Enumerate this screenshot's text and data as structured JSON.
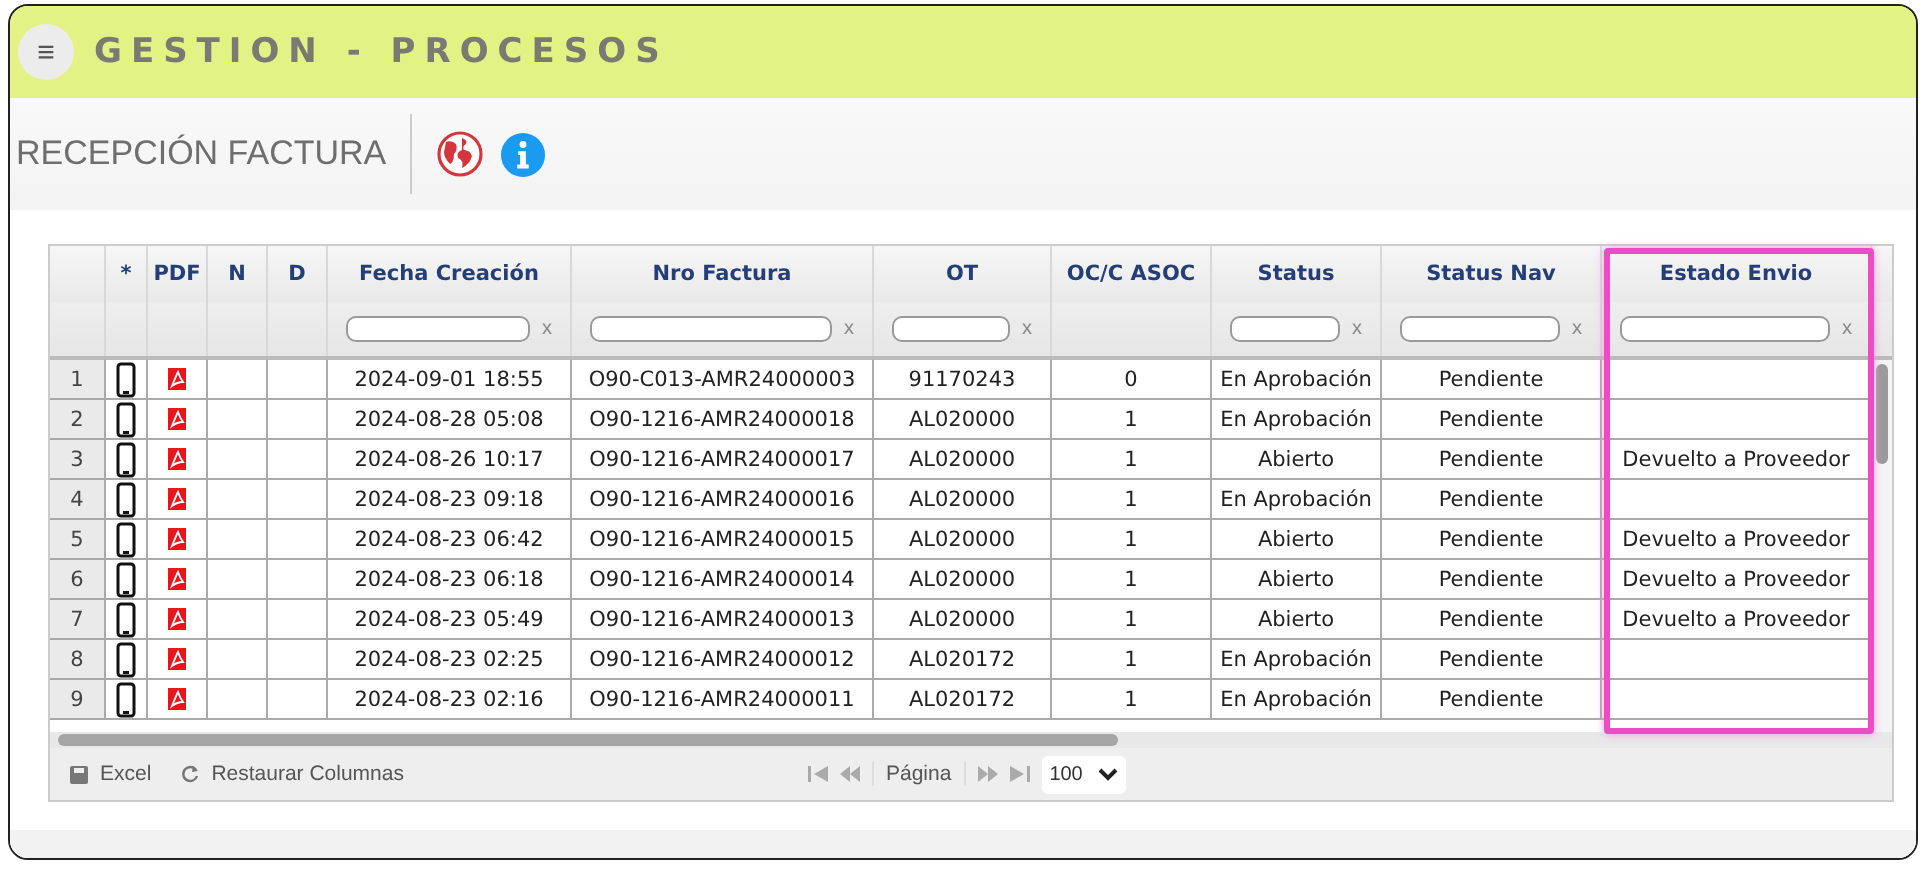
{
  "header": {
    "menu_icon": "≡",
    "title": "GESTION - PROCESOS"
  },
  "toolbar": {
    "title": "RECEPCIÓN FACTURA"
  },
  "table": {
    "columns": [
      {
        "kind": "row_number"
      },
      {
        "label": "*",
        "kind": "device"
      },
      {
        "label": "PDF",
        "kind": "pdf"
      },
      {
        "label": "N",
        "kind": "text"
      },
      {
        "label": "D",
        "kind": "text"
      },
      {
        "label": "Fecha Creación",
        "kind": "text",
        "filter_clear": "x"
      },
      {
        "label": "Nro Factura",
        "kind": "text",
        "filter_clear": "x"
      },
      {
        "label": "OT",
        "kind": "text",
        "filter_clear": "x"
      },
      {
        "label": "OC/C ASOC",
        "kind": "text"
      },
      {
        "label": "Status",
        "kind": "text",
        "filter_clear": "x"
      },
      {
        "label": "Status Nav",
        "kind": "text",
        "filter_clear": "x"
      },
      {
        "label": "Estado Envio",
        "kind": "text",
        "filter_clear": "x",
        "highlighted": true
      }
    ],
    "rows": [
      {
        "cells": [
          "1",
          "",
          "",
          "",
          "",
          "2024-09-01 18:55",
          "O90-C013-AMR24000003",
          "91170243",
          "0",
          "En Aprobación",
          "Pendiente",
          ""
        ]
      },
      {
        "cells": [
          "2",
          "",
          "",
          "",
          "",
          "2024-08-28 05:08",
          "O90-1216-AMR24000018",
          "AL020000",
          "1",
          "En Aprobación",
          "Pendiente",
          ""
        ]
      },
      {
        "cells": [
          "3",
          "",
          "",
          "",
          "",
          "2024-08-26 10:17",
          "O90-1216-AMR24000017",
          "AL020000",
          "1",
          "Abierto",
          "Pendiente",
          "Devuelto a Proveedor"
        ]
      },
      {
        "cells": [
          "4",
          "",
          "",
          "",
          "",
          "2024-08-23 09:18",
          "O90-1216-AMR24000016",
          "AL020000",
          "1",
          "En Aprobación",
          "Pendiente",
          ""
        ]
      },
      {
        "cells": [
          "5",
          "",
          "",
          "",
          "",
          "2024-08-23 06:42",
          "O90-1216-AMR24000015",
          "AL020000",
          "1",
          "Abierto",
          "Pendiente",
          "Devuelto a Proveedor"
        ]
      },
      {
        "cells": [
          "6",
          "",
          "",
          "",
          "",
          "2024-08-23 06:18",
          "O90-1216-AMR24000014",
          "AL020000",
          "1",
          "Abierto",
          "Pendiente",
          "Devuelto a Proveedor"
        ]
      },
      {
        "cells": [
          "7",
          "",
          "",
          "",
          "",
          "2024-08-23 05:49",
          "O90-1216-AMR24000013",
          "AL020000",
          "1",
          "Abierto",
          "Pendiente",
          "Devuelto a Proveedor"
        ]
      },
      {
        "cells": [
          "8",
          "",
          "",
          "",
          "",
          "2024-08-23 02:25",
          "O90-1216-AMR24000012",
          "AL020172",
          "1",
          "En Aprobación",
          "Pendiente",
          ""
        ]
      },
      {
        "cells": [
          "9",
          "",
          "",
          "",
          "",
          "2024-08-23 02:16",
          "O90-1216-AMR24000011",
          "AL020172",
          "1",
          "En Aprobación",
          "Pendiente",
          ""
        ]
      }
    ]
  },
  "footer": {
    "excel": "Excel",
    "restore": "Restaurar Columnas",
    "page_label": "Página",
    "page_size": "100"
  }
}
